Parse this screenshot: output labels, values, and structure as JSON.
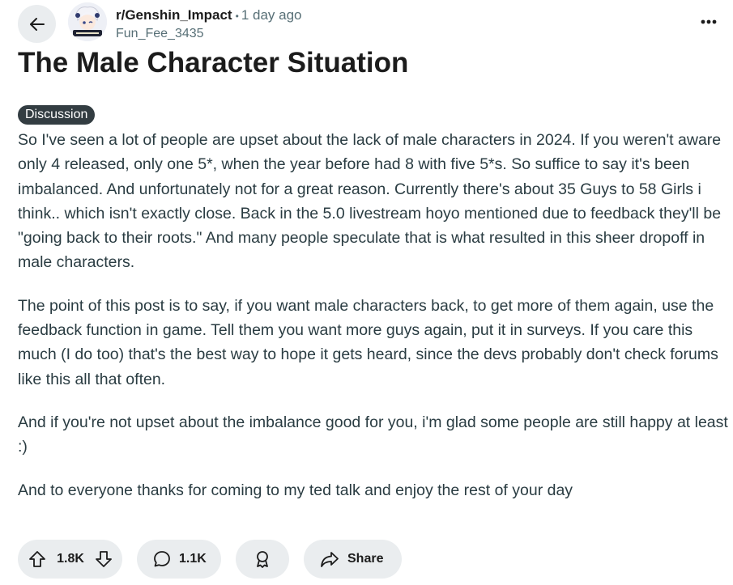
{
  "header": {
    "subreddit": "r/Genshin_Impact",
    "separator": "•",
    "time_ago": "1 day ago",
    "username": "Fun_Fee_3435"
  },
  "post": {
    "title": "The Male Character Situation",
    "flair": "Discussion",
    "paragraphs": [
      "So I've seen a lot of people are upset about the lack of male characters in 2024. If you weren't aware only 4 released, only one 5*, when the year before had 8 with five 5*s. So suffice to say it's been imbalanced. And unfortunately not for a great reason. Currently there's about 35 Guys to 58 Girls i think.. which isn't exactly close. Back in the 5.0 livestream hoyo mentioned due to feedback they'll be \"going back to their roots.\" And many people speculate that is what resulted in this sheer dropoff in male characters.",
      "The point of this post is to say, if you want male characters back, to get more of them again, use the feedback function in game. Tell them you want more guys again, put it in surveys. If you care this much (I do too) that's the best way to hope it gets heard, since the devs probably don't check forums like this all that often.",
      "And if you're not upset about the imbalance good for you, i'm glad some people are still happy at least :)",
      "And to everyone thanks for coming to my ted talk and enjoy the rest of your day"
    ]
  },
  "actions": {
    "upvotes": "1.8K",
    "comments": "1.1K",
    "share_label": "Share"
  },
  "icons": {
    "back": "arrow-left-icon",
    "more": "more-horizontal-icon",
    "upvote": "upvote-arrow-icon",
    "downvote": "downvote-arrow-icon",
    "comment": "comment-bubble-icon",
    "award": "award-icon",
    "share": "share-arrow-icon"
  },
  "colors": {
    "pill_background": "#eaedef",
    "flair_background": "#333d42",
    "meta_text": "#576f76",
    "body_text": "#2a3c42"
  }
}
